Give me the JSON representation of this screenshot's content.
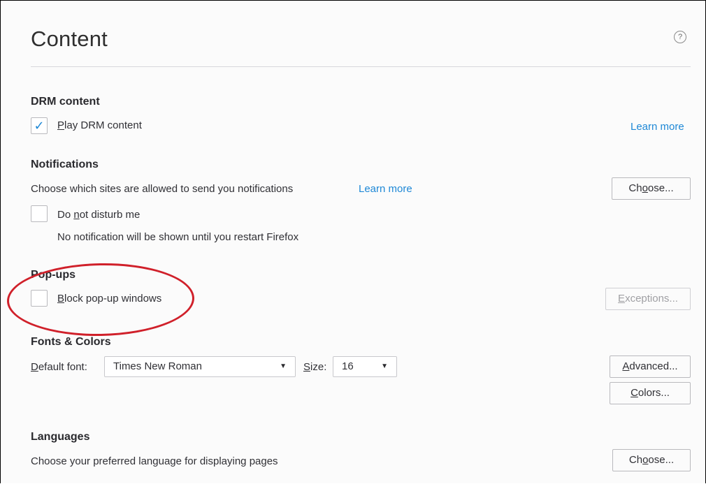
{
  "page": {
    "title": "Content",
    "help_icon_glyph": "?"
  },
  "drm": {
    "heading": "DRM content",
    "checkbox_label": "Play DRM content",
    "checkbox_checked": true,
    "learn_more": "Learn more"
  },
  "notifications": {
    "heading": "Notifications",
    "description": "Choose which sites are allowed to send you notifications",
    "learn_more": "Learn more",
    "choose_button": "Choose...",
    "dnd_label": "Do not disturb me",
    "dnd_checked": false,
    "dnd_note": "No notification will be shown until you restart Firefox"
  },
  "popups": {
    "heading": "Pop-ups",
    "block_label": "Block pop-up windows",
    "block_checked": false,
    "exceptions_button": "Exceptions..."
  },
  "fonts": {
    "heading": "Fonts & Colors",
    "default_font_label": "Default font:",
    "default_font_value": "Times New Roman",
    "size_label": "Size:",
    "size_value": "16",
    "advanced_button": "Advanced...",
    "colors_button": "Colors..."
  },
  "languages": {
    "heading": "Languages",
    "description": "Choose your preferred language for displaying pages",
    "choose_button": "Choose..."
  },
  "annotation": {
    "highlight_color": "#d0202a"
  },
  "icons": {
    "help": "help-circle-icon",
    "check": "checkmark-icon",
    "dropdown": "dropdown-arrow-icon"
  }
}
